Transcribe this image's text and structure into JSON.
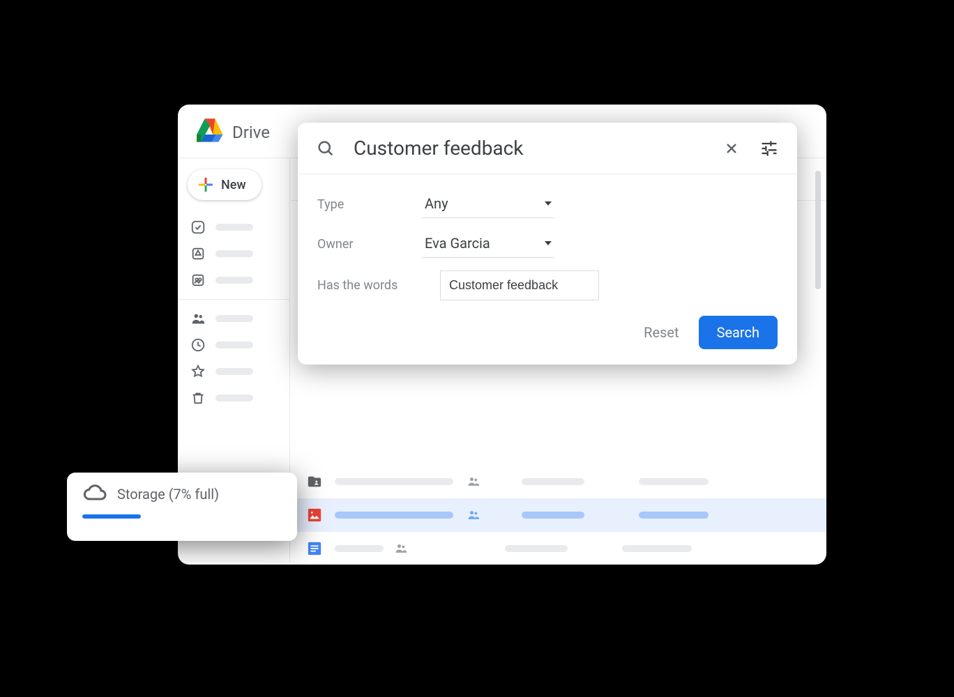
{
  "app": {
    "title": "Drive"
  },
  "new_button": {
    "label": "New"
  },
  "search": {
    "query": "Customer feedback",
    "filters": {
      "type": {
        "label": "Type",
        "value": "Any"
      },
      "owner": {
        "label": "Owner",
        "value": "Eva Garcia"
      },
      "has_words": {
        "label": "Has the words",
        "value": "Customer feedback"
      }
    },
    "reset_label": "Reset",
    "search_label": "Search"
  },
  "storage": {
    "label": "Storage (7% full)",
    "percent": 7
  }
}
